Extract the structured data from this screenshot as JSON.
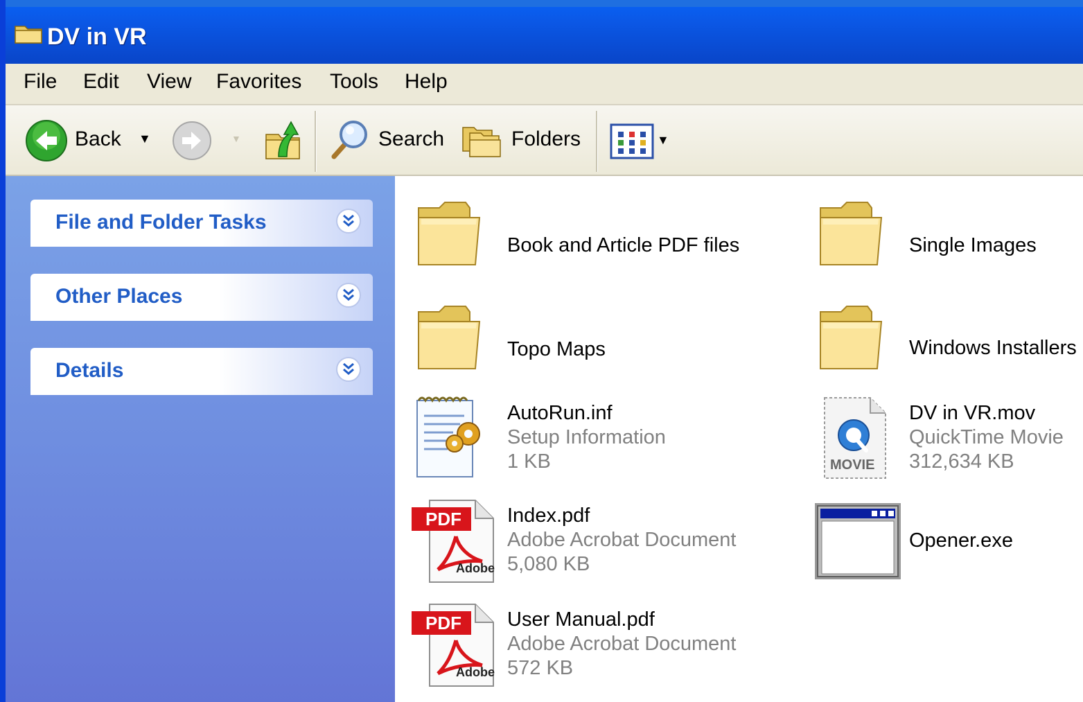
{
  "window": {
    "title": "DV in VR"
  },
  "menu": [
    "File",
    "Edit",
    "View",
    "Favorites",
    "Tools",
    "Help"
  ],
  "toolbar": {
    "back_label": "Back",
    "search_label": "Search",
    "folders_label": "Folders"
  },
  "tasks": [
    "File and Folder Tasks",
    "Other Places",
    "Details"
  ],
  "items": [
    {
      "name": "Book and Article PDF files",
      "icon": "folder-icon"
    },
    {
      "name": "Single Images",
      "icon": "folder-icon"
    },
    {
      "name": "Topo Maps",
      "icon": "folder-icon"
    },
    {
      "name": "Windows Installers",
      "icon": "folder-icon"
    },
    {
      "name": "AutoRun.inf",
      "type": "Setup Information",
      "size": "1 KB",
      "icon": "setup-file-icon"
    },
    {
      "name": "DV in VR.mov",
      "type": "QuickTime Movie",
      "size": "312,634 KB",
      "icon": "quicktime-movie-icon",
      "icon_label": "MOVIE"
    },
    {
      "name": "Index.pdf",
      "type": "Adobe Acrobat Document",
      "size": "5,080 KB",
      "icon": "pdf-file-icon",
      "icon_badge": "PDF",
      "icon_brand": "Adobe"
    },
    {
      "name": "Opener.exe",
      "icon": "application-icon"
    },
    {
      "name": "User Manual.pdf",
      "type": "Adobe Acrobat Document",
      "size": "572 KB",
      "icon": "pdf-file-icon",
      "icon_badge": "PDF",
      "icon_brand": "Adobe"
    }
  ],
  "colors": {
    "title_bar": "#0a4fd8",
    "task_title": "#215dc6",
    "left_pane": "#6f8ee0",
    "menu_bar": "#ece9d8"
  }
}
